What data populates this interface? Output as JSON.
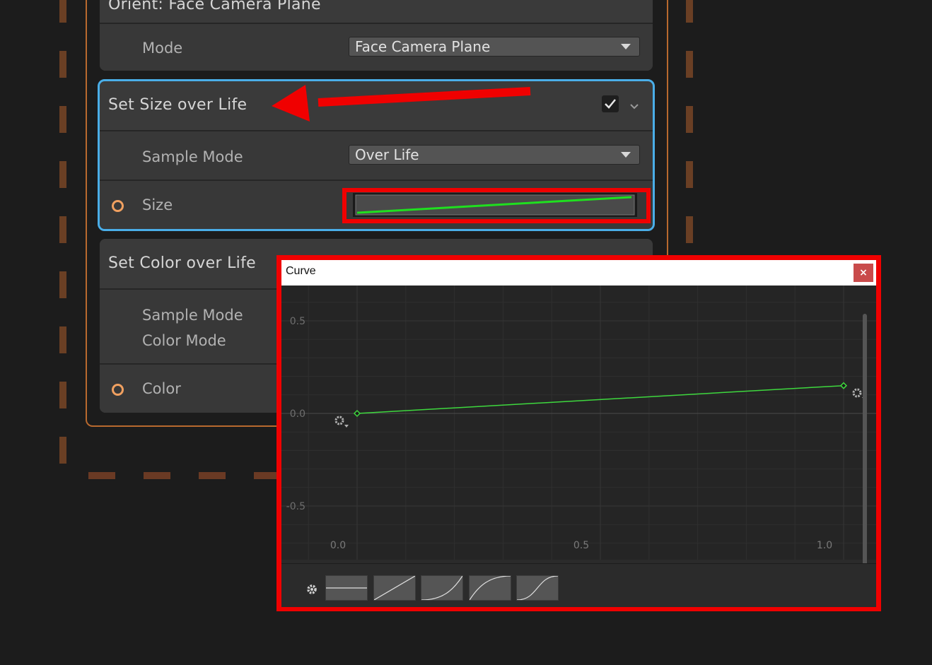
{
  "context": {
    "orient_block": {
      "title": "Orient: Face Camera Plane",
      "mode_label": "Mode",
      "mode_value": "Face Camera Plane"
    },
    "size_block": {
      "title": "Set Size over Life",
      "enabled": true,
      "sample_mode_label": "Sample Mode",
      "sample_mode_value": "Over Life",
      "size_label": "Size"
    },
    "color_block": {
      "title": "Set Color over Life",
      "sample_mode_label": "Sample Mode",
      "color_mode_label": "Color Mode",
      "color_label": "Color"
    }
  },
  "curve_window": {
    "title": "Curve",
    "close_label": "×",
    "y_ticks": [
      "0.5",
      "0.0",
      "-0.5"
    ],
    "x_ticks": [
      "0.0",
      "0.5",
      "1.0"
    ],
    "keys": [
      {
        "time": 0.0,
        "value": 0.0
      },
      {
        "time": 1.0,
        "value": 0.15
      }
    ],
    "curve_color": "#3ed83e",
    "presets": [
      "constant",
      "linear",
      "ease-in",
      "ease-out",
      "ease-in-out"
    ]
  },
  "colors": {
    "accent_selected": "#4aaee8",
    "highlight_red": "#f00000",
    "context_orange": "#b8692e",
    "port_orange": "#f0a060"
  }
}
